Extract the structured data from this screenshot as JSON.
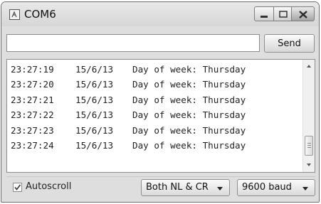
{
  "window": {
    "title": "COM6"
  },
  "input": {
    "value": "",
    "send_label": "Send"
  },
  "output": {
    "lines": [
      {
        "time": "23:27:19",
        "date": "15/6/13",
        "text": "Day of week: Thursday"
      },
      {
        "time": "23:27:20",
        "date": "15/6/13",
        "text": "Day of week: Thursday"
      },
      {
        "time": "23:27:21",
        "date": "15/6/13",
        "text": "Day of week: Thursday"
      },
      {
        "time": "23:27:22",
        "date": "15/6/13",
        "text": "Day of week: Thursday"
      },
      {
        "time": "23:27:23",
        "date": "15/6/13",
        "text": "Day of week: Thursday"
      },
      {
        "time": "23:27:24",
        "date": "15/6/13",
        "text": "Day of week: Thursday"
      }
    ]
  },
  "footer": {
    "autoscroll_label": "Autoscroll",
    "autoscroll_checked": true,
    "line_ending": "Both NL & CR",
    "baud_rate": "9600 baud"
  }
}
